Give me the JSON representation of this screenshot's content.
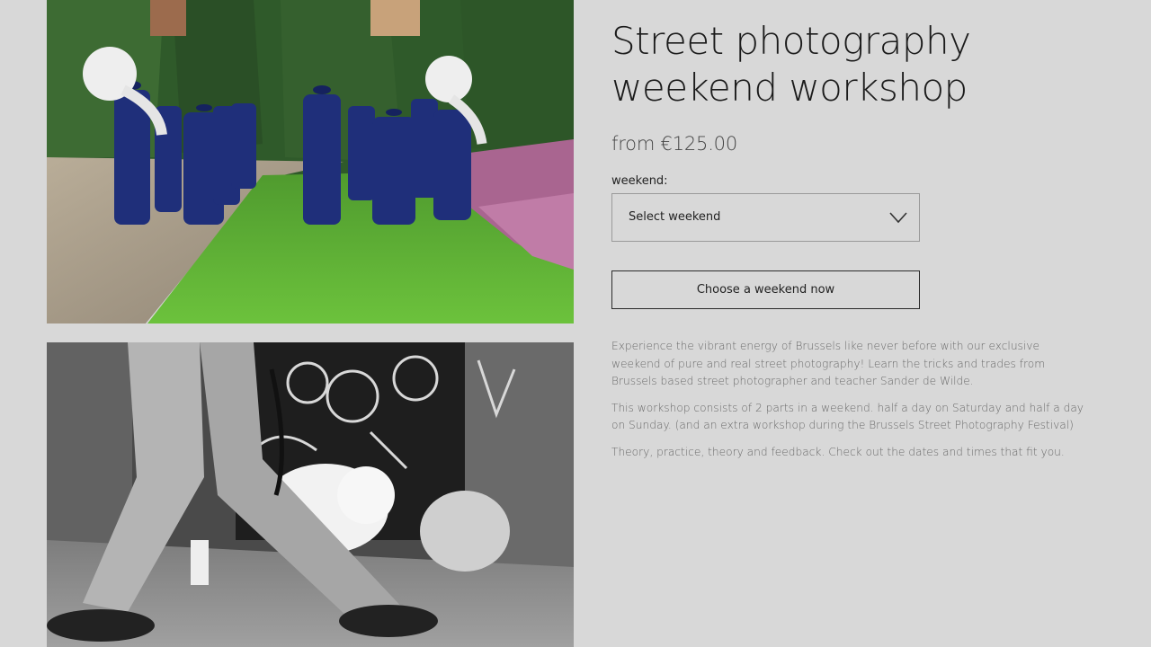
{
  "gallery": {
    "images": [
      {
        "alt": "Marching band in blue uniforms with sousaphones on a lawn",
        "icon": "photo-marching-band"
      },
      {
        "alt": "Black and white street photo of a person walking a white dog past graffiti",
        "icon": "photo-dog-walker"
      }
    ]
  },
  "product": {
    "title": "Street photography weekend workshop",
    "price": "from €125.00",
    "variant_label": "weekend:",
    "variant_select": {
      "selected": "Select weekend",
      "icon": "chevron-down-icon"
    },
    "cta_label": "Choose a weekend now",
    "description": [
      "Experience the vibrant energy of Brussels like never before with our exclusive weekend of pure and real street photography! Learn the tricks and trades from Brussels based street photographer and teacher Sander de Wilde.",
      "This workshop consists of 2 parts in a weekend. half a day on Saturday and half a day on Sunday. (and an extra workshop during the Brussels Street Photography Festival)",
      "Theory, practice, theory and feedback. Check out the dates and times that fit you."
    ]
  },
  "colors": {
    "background": "#d8d8d8",
    "text": "#1b1b1b",
    "muted_text": "#6a6a6a",
    "border": "#9a9a9a"
  }
}
